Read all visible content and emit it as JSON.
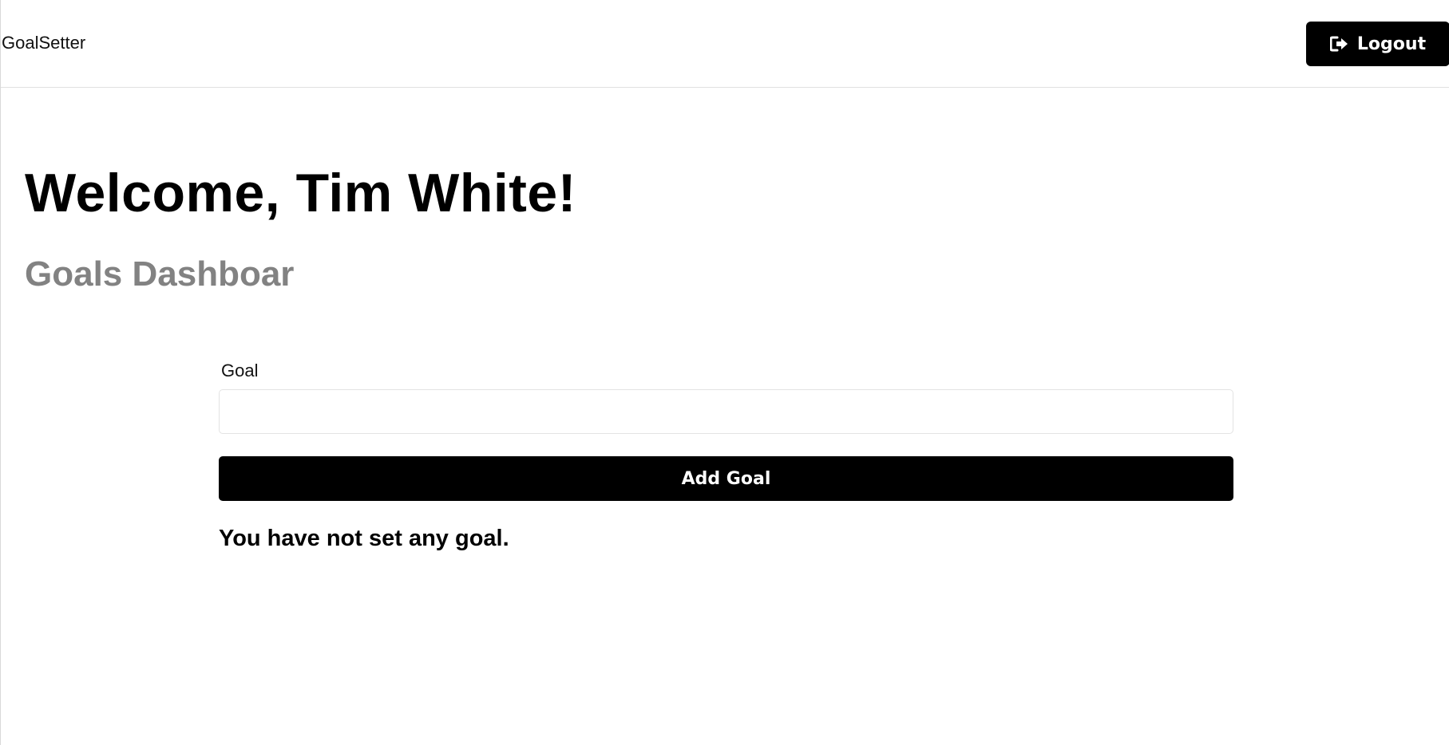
{
  "header": {
    "logo": "GoalSetter",
    "logout_label": "Logout",
    "logout_icon": "sign-out-icon"
  },
  "main": {
    "welcome": "Welcome, Tim White!",
    "subtitle": "Goals Dashboar"
  },
  "goal_form": {
    "label": "Goal",
    "input_value": "",
    "placeholder": "",
    "submit_label": "Add Goal"
  },
  "goals": {
    "empty_message": "You have not set any goal."
  },
  "colors": {
    "primary": "#000000",
    "background": "#ffffff",
    "subtitle": "#828282",
    "border": "#e3e3e3"
  }
}
